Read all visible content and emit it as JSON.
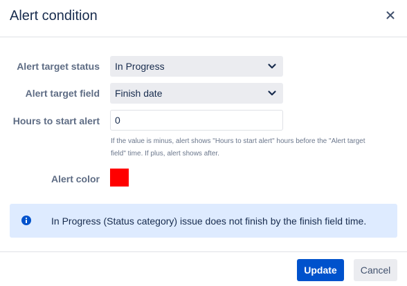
{
  "dialog": {
    "title": "Alert condition",
    "close_icon": "close-icon"
  },
  "form": {
    "target_status": {
      "label": "Alert target status",
      "value": "In Progress"
    },
    "target_field": {
      "label": "Alert target field",
      "value": "Finish date"
    },
    "hours_to_start": {
      "label": "Hours to start alert",
      "value": "0",
      "help_line1": "If the value is minus, alert shows \"Hours to start alert\" hours before the \"Alert target",
      "help_line2": "field\" time. If plus, alert shows after."
    },
    "alert_color": {
      "label": "Alert color",
      "value": "#ff0000"
    }
  },
  "info": {
    "icon": "info-icon",
    "text": "In Progress (Status category) issue does not finish by the finish field time."
  },
  "footer": {
    "update_label": "Update",
    "cancel_label": "Cancel"
  },
  "colors": {
    "primary": "#0052cc",
    "info_bg": "#deebff",
    "select_bg": "#ebecf0"
  }
}
